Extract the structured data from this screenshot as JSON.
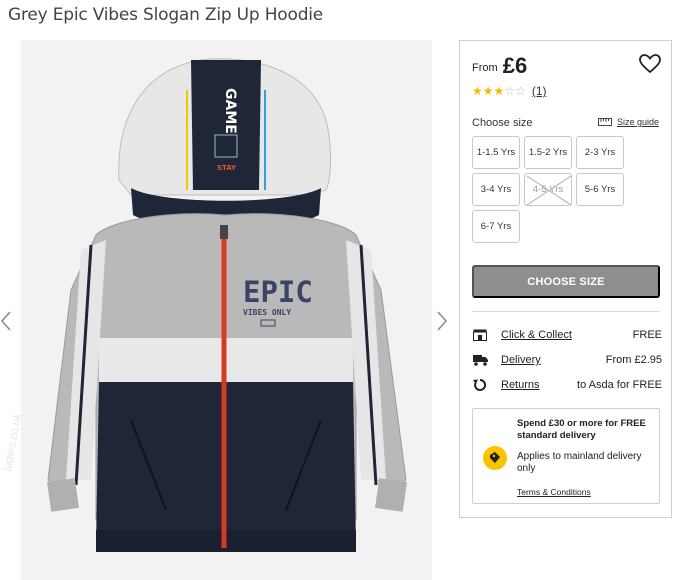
{
  "product": {
    "title": "Grey Epic Vibes Slogan Zip Up Hoodie",
    "from_label": "From",
    "price": "£6",
    "rating": 3,
    "rating_max": 5,
    "review_count": "(1)",
    "graphic_text_main": "EPIC",
    "graphic_text_sub": "VIBES ONLY",
    "hood_text": "GAME"
  },
  "sizes": {
    "label": "Choose size",
    "guide_label": "Size guide",
    "options": [
      {
        "label": "1-1.5 Yrs",
        "available": true
      },
      {
        "label": "1.5-2 Yrs",
        "available": true
      },
      {
        "label": "2-3 Yrs",
        "available": true
      },
      {
        "label": "3-4 Yrs",
        "available": true
      },
      {
        "label": "4-5 Yrs",
        "available": false
      },
      {
        "label": "5-6 Yrs",
        "available": true
      },
      {
        "label": "6-7 Yrs",
        "available": true
      }
    ]
  },
  "cta": {
    "label": "CHOOSE SIZE"
  },
  "delivery": [
    {
      "icon": "store-icon",
      "label": "Click & Collect",
      "value": "FREE"
    },
    {
      "icon": "truck-icon",
      "label": "Delivery",
      "value": "From £2.95"
    },
    {
      "icon": "return-icon",
      "label": "Returns",
      "value": "to Asda for FREE"
    }
  ],
  "promo": {
    "headline": "Spend £30 or more for FREE standard delivery",
    "note": "Applies to mainland delivery only",
    "terms": "Terms & Conditions",
    "icon": "tag-icon"
  },
  "watermark": "ladies.co.uk",
  "colors": {
    "accent_yellow": "#f9c300",
    "star": "#f5b900",
    "cta_disabled": "#8e8e8e",
    "zip_red": "#d63a1f",
    "navy": "#1f2638"
  }
}
